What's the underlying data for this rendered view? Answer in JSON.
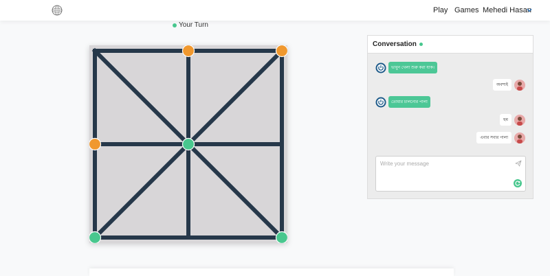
{
  "nav": {
    "logo_icon": "sphere-logo-icon",
    "play": "Play",
    "games": "Games",
    "user": "Mehedi Hasan",
    "chevron_icon": "chevron-down-icon"
  },
  "game": {
    "turn_label": "Your Turn",
    "board_color": "#d8d6d8",
    "line_color": "#26384a",
    "player_color": "#48c78e",
    "opponent_color": "#f0982e",
    "pieces": [
      {
        "side": "opponent",
        "node": "top-center"
      },
      {
        "side": "opponent",
        "node": "top-right"
      },
      {
        "side": "opponent",
        "node": "middle-left"
      },
      {
        "side": "player",
        "node": "center"
      },
      {
        "side": "player",
        "node": "bottom-left"
      },
      {
        "side": "player",
        "node": "bottom-right"
      }
    ]
  },
  "chat": {
    "title": "Conversation",
    "messages": [
      {
        "from": "bot",
        "text": "ভাবুন খেলা শুরু করা যাক।"
      },
      {
        "from": "user",
        "text": "অবশ্যই"
      },
      {
        "from": "bot",
        "text": "তোমার চালনোর পালা"
      },
      {
        "from": "user",
        "text": "হুম"
      },
      {
        "from": "user",
        "text": "এবার সবার পালা"
      }
    ],
    "compose_placeholder": "Write your message",
    "send_icon": "paper-plane-icon",
    "refresh_icon": "refresh-icon"
  }
}
